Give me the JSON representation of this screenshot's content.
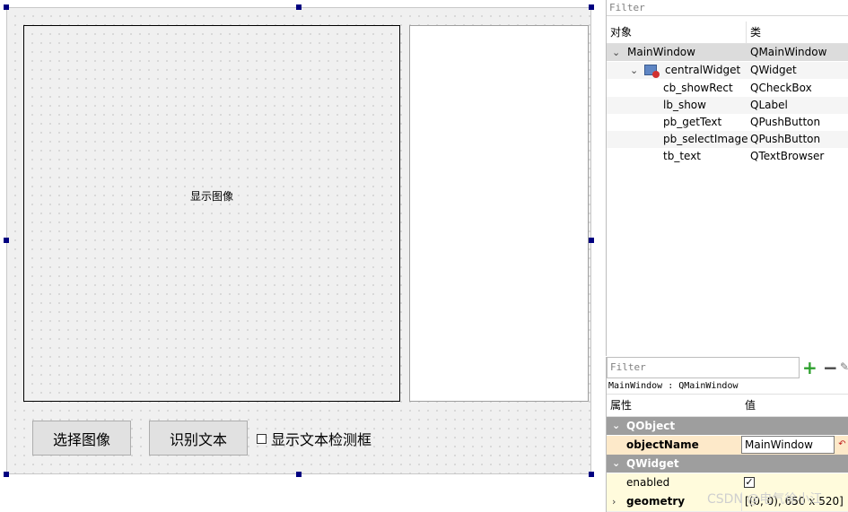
{
  "form": {
    "label_text": "显示图像",
    "button_select": "选择图像",
    "button_recognize": "识别文本",
    "checkbox_label": "显示文本检测框"
  },
  "object_inspector": {
    "filter_placeholder": "Filter",
    "col_object": "对象",
    "col_class": "类",
    "rows": [
      {
        "name": "MainWindow",
        "class": "QMainWindow"
      },
      {
        "name": "centralWidget",
        "class": "QWidget"
      },
      {
        "name": "cb_showRect",
        "class": "QCheckBox"
      },
      {
        "name": "lb_show",
        "class": "QLabel"
      },
      {
        "name": "pb_getText",
        "class": "QPushButton"
      },
      {
        "name": "pb_selectImage",
        "class": "QPushButton"
      },
      {
        "name": "tb_text",
        "class": "QTextBrowser"
      }
    ]
  },
  "property_editor": {
    "filter_placeholder": "Filter",
    "current_object": "MainWindow : QMainWindow",
    "col_property": "属性",
    "col_value": "值",
    "groups": [
      {
        "name": "QObject"
      },
      {
        "name": "QWidget"
      }
    ],
    "object_name_key": "objectName",
    "object_name_value": "MainWindow",
    "enabled_key": "enabled",
    "enabled_checked": true,
    "geometry_key": "geometry",
    "geometry_value": "[(0, 0), 650 x 520]"
  },
  "watermark": "CSDN @电气徐小江"
}
